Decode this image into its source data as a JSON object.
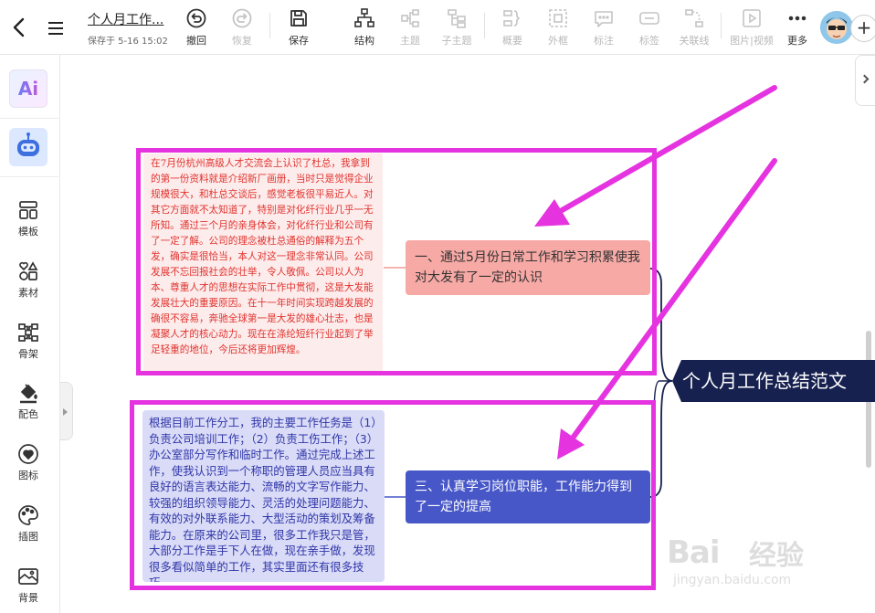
{
  "header": {
    "doc_title": "个人月工作...",
    "saved_text": "保存于 5-16 15:02",
    "tools": [
      {
        "id": "undo",
        "label": "撤回",
        "icon": "undo-icon",
        "enabled": true
      },
      {
        "id": "redo",
        "label": "恢复",
        "icon": "redo-icon",
        "enabled": false
      },
      {
        "id": "save",
        "label": "保存",
        "icon": "save-icon",
        "enabled": true
      },
      {
        "id": "structure",
        "label": "结构",
        "icon": "structure-icon",
        "enabled": true
      },
      {
        "id": "topic",
        "label": "主题",
        "icon": "topic-icon",
        "enabled": false
      },
      {
        "id": "subtopic",
        "label": "子主题",
        "icon": "subtopic-icon",
        "enabled": false
      },
      {
        "id": "summary",
        "label": "概要",
        "icon": "summary-icon",
        "enabled": false
      },
      {
        "id": "frame",
        "label": "外框",
        "icon": "frame-icon",
        "enabled": false
      },
      {
        "id": "note",
        "label": "标注",
        "icon": "note-icon",
        "enabled": false
      },
      {
        "id": "tag",
        "label": "标签",
        "icon": "tag-icon",
        "enabled": false
      },
      {
        "id": "relation",
        "label": "关联线",
        "icon": "relation-line-icon",
        "enabled": false
      },
      {
        "id": "media",
        "label": "图片|视频",
        "icon": "image-video-icon",
        "enabled": false
      },
      {
        "id": "more",
        "label": "更多",
        "icon": "more-icon",
        "enabled": true
      }
    ],
    "add_symbol": "+"
  },
  "sidebar": {
    "ai_label": "Ai",
    "items": [
      {
        "id": "template",
        "label": "模板",
        "icon": "template-icon"
      },
      {
        "id": "material",
        "label": "素材",
        "icon": "material-icon"
      },
      {
        "id": "skeleton",
        "label": "骨架",
        "icon": "skeleton-icon"
      },
      {
        "id": "color",
        "label": "配色",
        "icon": "color-palette-icon"
      },
      {
        "id": "sticker",
        "label": "图标",
        "icon": "heart-icon"
      },
      {
        "id": "illustration",
        "label": "插图",
        "icon": "illustration-icon"
      },
      {
        "id": "background",
        "label": "背景",
        "icon": "background-icon"
      }
    ]
  },
  "mindmap": {
    "central_topic": "个人月工作总结范文",
    "topic_1": "一、通过5月份日常工作和学习积累使我对大发有了一定的认识",
    "topic_3": "三、认真学习岗位职能，工作能力得到了一定的提高",
    "note_1": "在7月份杭州高级人才交流会上认识了杜总，我拿到的第一份资料就是介绍新厂画册，当时只是觉得企业规模很大，和杜总交谈后，感觉老板很平易近人。对其它方面就不太知道了，特别是对化纤行业几乎一无所知。通过三个月的亲身体会，对化纤行业和公司有了一定了解。公司的理念被杜总通俗的解释为五个发，确实是很恰当，本人对这一理念非常认同。公司发展不忘回报社会的壮举，令人敬佩。公司以人为本、尊重人才的思想在实际工作中贯彻，这是大发能发展壮大的重要原因。在十一年时间实现跨越发展的确很不容易，奔驰全球第一是大发的雄心壮志，也是凝聚人才的核心动力。现在在涤纶短纤行业起到了举足轻重的地位，今后还将更加辉煌。",
    "note_3": "根据目前工作分工，我的主要工作任务是（1）负责公司培训工作；（2）负责工伤工作；（3）办公室部分写作和临时工作。通过完成上述工作，使我认识到一个称职的管理人员应当具有良好的语言表达能力、流畅的文字写作能力、较强的组织领导能力、灵活的处理问题能力、有效的对外联系能力、大型活动的策划及筹备能力。在原来的公司里，很多工作我只是管，大部分工作是手下人在做，现在亲手做，发现很多看似简单的工作，其实里面还有很多技巧。"
  },
  "watermark": {
    "logo": "Bai",
    "brand": "经验",
    "url": "jingyan.baidu.com"
  },
  "colors": {
    "highlight": "#e533e0",
    "central_bg": "#17214f",
    "topic_1_bg": "#f7a9a5",
    "topic_3_bg": "#4757c8",
    "note_1_text": "#e0342e",
    "note_3_text": "#3036a8"
  }
}
